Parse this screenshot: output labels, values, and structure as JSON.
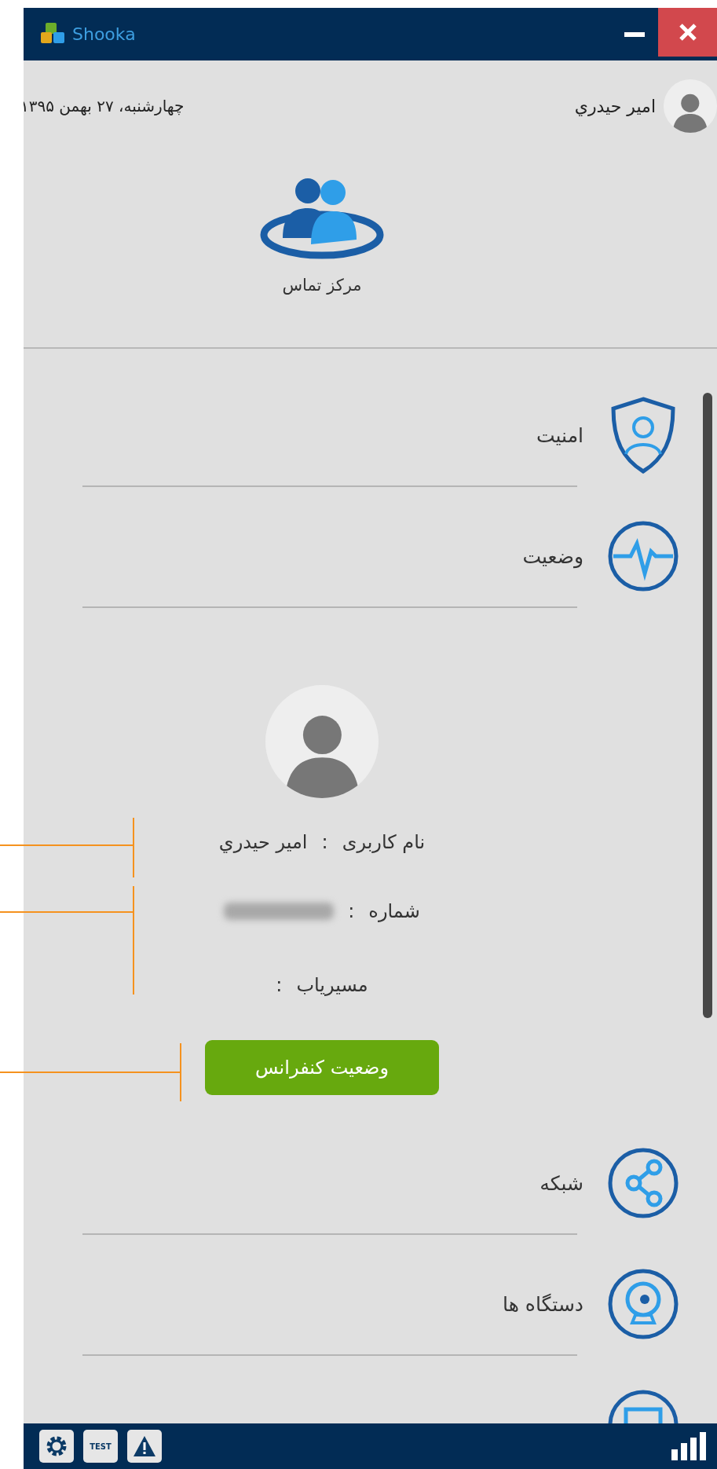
{
  "window": {
    "title": "Shooka"
  },
  "header": {
    "user_name": "امير حيدري",
    "date": "چهارشنبه، ۲۷ بهمن ۱۳۹۵",
    "section_label": "مرکز تماس"
  },
  "menu_top": [
    {
      "label": "امنیت"
    },
    {
      "label": "وضعیت"
    }
  ],
  "profile": {
    "fields": [
      {
        "label": "نام کاربری",
        "separator": ":",
        "value": "امير حيدري",
        "redacted": false
      },
      {
        "label": "شماره",
        "separator": ":",
        "redacted": true
      },
      {
        "label": "مسيرياب",
        "separator": ":",
        "redacted": false
      }
    ],
    "button": "وضعیت کنفرانس"
  },
  "menu_bottom": [
    {
      "label": "شبکه"
    },
    {
      "label": "دستگاه ها"
    }
  ],
  "status_bar": {
    "test_label": "TEST"
  }
}
